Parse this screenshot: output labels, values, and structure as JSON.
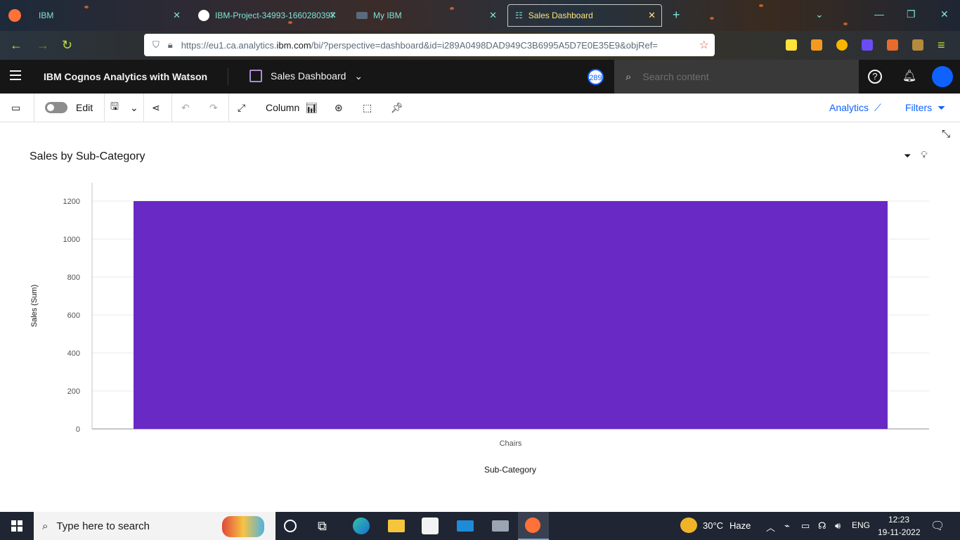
{
  "browser": {
    "tabs": [
      {
        "title": "IBM",
        "active": false
      },
      {
        "title": "IBM-Project-34993-1660280397",
        "active": false
      },
      {
        "title": "My IBM",
        "active": false
      },
      {
        "title": "Sales Dashboard",
        "active": true
      }
    ],
    "url_prefix": "https://eu1.ca.analytics.",
    "url_domain": "ibm.com",
    "url_suffix": "/bi/?perspective=dashboard&id=i289A0498DAD949C3B6995A5D7E0E35E9&objRef="
  },
  "app": {
    "brand": "IBM Cognos Analytics with Watson",
    "dashboard_name": "Sales Dashboard",
    "notification_badge": "289",
    "search_placeholder": "Search content"
  },
  "toolbar": {
    "edit_label": "Edit",
    "visualization_type": "Column",
    "analytics_label": "Analytics",
    "filters_label": "Filters"
  },
  "widget": {
    "title": "Sales by Sub-Category"
  },
  "chart_data": {
    "type": "bar",
    "categories": [
      "Chairs"
    ],
    "values": [
      1200
    ],
    "xlabel": "Sub-Category",
    "ylabel": "Sales (Sum)",
    "ylim": [
      0,
      1200
    ],
    "yticks": [
      0,
      200,
      400,
      600,
      800,
      1000,
      1200
    ],
    "grid": true,
    "bar_color": "#6929c4"
  },
  "taskbar": {
    "search_placeholder": "Type here to search",
    "weather_temp": "30°C",
    "weather_desc": "Haze",
    "language": "ENG",
    "time": "12:23",
    "date": "19-11-2022"
  }
}
